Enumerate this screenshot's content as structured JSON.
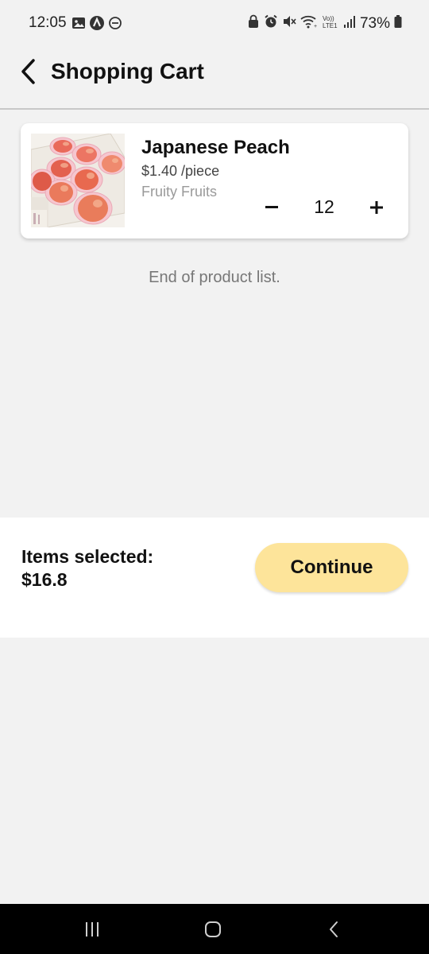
{
  "status_bar": {
    "time": "12:05",
    "battery": "73%",
    "left_icons": [
      "image-icon",
      "app-icon",
      "dnd-icon"
    ],
    "right_icons": [
      "lock-icon",
      "alarm-icon",
      "mute-icon",
      "wifi-icon",
      "volte-icon",
      "signal-icon",
      "battery-icon"
    ]
  },
  "header": {
    "title": "Shopping Cart",
    "back_icon": "chevron-left-icon"
  },
  "cart": {
    "items": [
      {
        "name": "Japanese Peach",
        "price": "$1.40 /piece",
        "seller": "Fruity Fruits",
        "quantity": "12",
        "minus_label": "−",
        "plus_label": "+"
      }
    ],
    "end_text": "End of product list."
  },
  "summary": {
    "label": "Items selected:",
    "total": "$16.8",
    "continue_label": "Continue"
  },
  "nav_bar": {
    "icons": [
      "recent-apps-icon",
      "home-icon",
      "back-icon"
    ]
  },
  "colors": {
    "background": "#f2f2f2",
    "card": "#ffffff",
    "accent_button": "#fde49a",
    "muted_text": "#9a9a9a",
    "nav_bar": "#000000"
  }
}
